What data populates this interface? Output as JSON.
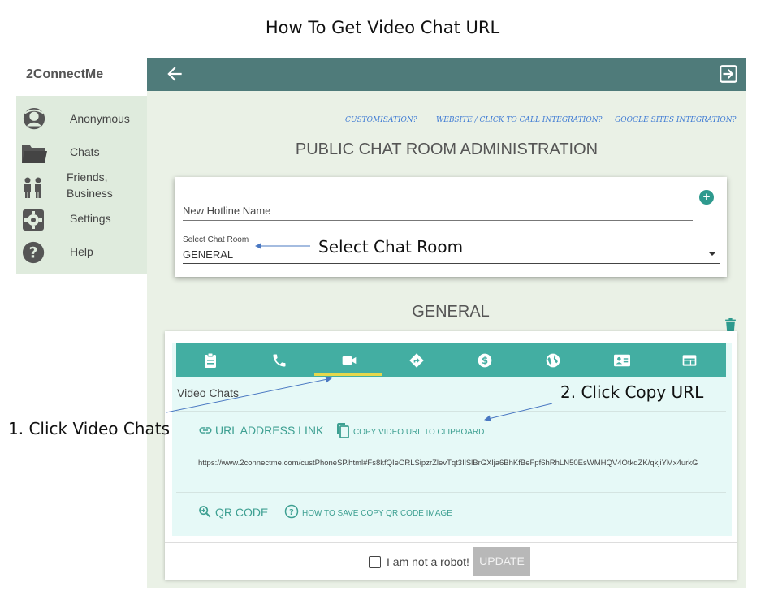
{
  "slide_title": "How To Get Video Chat URL",
  "app": {
    "brand": "2ConnectMe"
  },
  "sidebar": {
    "items": [
      {
        "label": "Anonymous",
        "icon": "anonymous-avatar-icon"
      },
      {
        "label": "Chats",
        "icon": "folder-icon"
      },
      {
        "label_line1": "Friends,",
        "label_line2": "Business",
        "icon": "people-icon"
      },
      {
        "label": "Settings",
        "icon": "gear-icon"
      },
      {
        "label": "Help",
        "icon": "help-icon"
      }
    ]
  },
  "header": {
    "back_icon": "arrow-left-icon",
    "exit_icon": "exit-icon"
  },
  "links": {
    "customisation": "CUSTOMISATION?",
    "website": "WEBSITE / CLICK TO CALL INTEGRATION?",
    "google": "GOOGLE SITES INTEGRATION?"
  },
  "admin_title": "PUBLIC CHAT ROOM ADMINISTRATION",
  "form": {
    "hotline_label": "New Hotline Name",
    "select_label": "Select Chat Room",
    "select_value": "GENERAL"
  },
  "annotations": {
    "select_chat_room": "Select Chat Room",
    "click_video_chats": "1. Click Video Chats",
    "click_copy_url": "2. Click Copy URL"
  },
  "room": {
    "title": "GENERAL",
    "tabs": [
      "clipboard-icon",
      "phone-icon",
      "videocam-icon",
      "directions-icon",
      "dollar-icon",
      "globe-icon",
      "contact-card-icon",
      "web-window-icon"
    ],
    "active_tab": 2,
    "section_label": "Video Chats",
    "url_link": "URL ADDRESS LINK",
    "copy_button": "COPY VIDEO URL TO CLIPBOARD",
    "url": "https://www.2connectme.com/custPhoneSP.html#Fs8kfQIeORLSipzrZlevTqt3IlSlBrGXlja6BhKfBeFpf6hRhLN50EsWMHQV4OtkdZK/qkjiYMx4urkG",
    "qr_code": "QR CODE",
    "how_to_save": "HOW TO SAVE COPY QR CODE IMAGE",
    "robot_label": "I am not a robot!",
    "update_button": "UPDATE"
  },
  "colors": {
    "topbar": "#4f7b7a",
    "teal": "#43aea2",
    "accent_underline": "#e6d84c",
    "sidebar_bg": "#dfebdd",
    "main_bg": "#eaf1e6",
    "link_blue": "#3f7bd4"
  }
}
